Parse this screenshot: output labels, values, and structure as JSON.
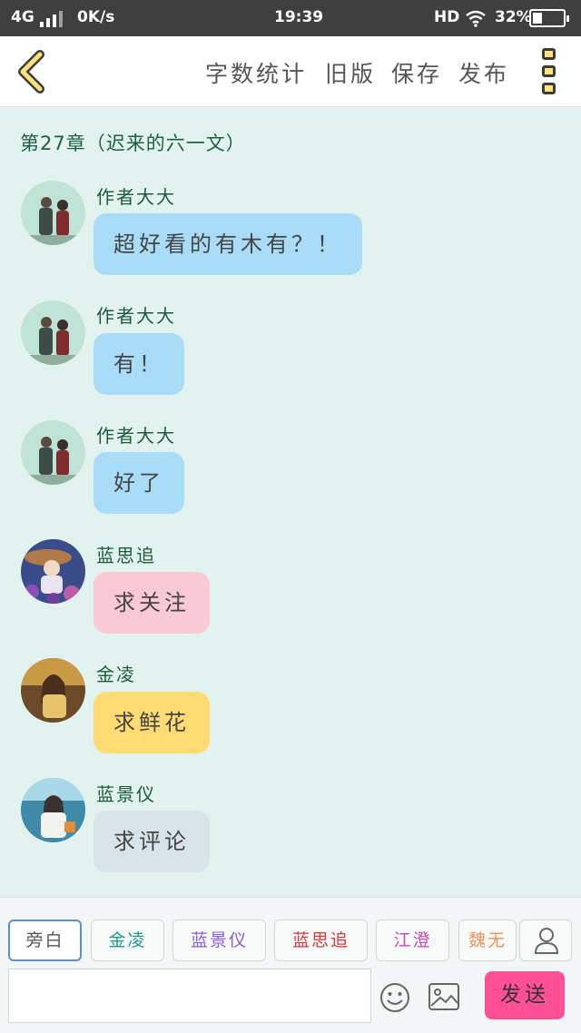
{
  "status_bar": {
    "network": "4G",
    "speed": "0K/s",
    "time": "19:39",
    "hd": "HD",
    "battery": "32%",
    "battery_level": 0.32
  },
  "toolbar": {
    "word_count": "字数统计",
    "old_version": "旧版",
    "save": "保存",
    "publish": "发布",
    "icons": {
      "back": "chevron-left-icon",
      "more": "more-vertical-icon"
    }
  },
  "chapter_title": "第27章（迟来的六一文）",
  "messages": [
    {
      "name": "作者大大",
      "text": "超好看的有木有？！",
      "bubble_color": "#a9dcf6"
    },
    {
      "name": "作者大大",
      "text": "有！",
      "bubble_color": "#a9dcf6"
    },
    {
      "name": "作者大大",
      "text": "好了",
      "bubble_color": "#a9dcf6"
    },
    {
      "name": "蓝思追",
      "text": "求关注",
      "bubble_color": "#f9c9d6"
    },
    {
      "name": "金凌",
      "text": "求鲜花",
      "bubble_color": "#fedb73"
    },
    {
      "name": "蓝景仪",
      "text": "求评论",
      "bubble_color": "#d9e4e9"
    }
  ],
  "roles": [
    {
      "label": "旁白",
      "color": "#555555"
    },
    {
      "label": "金凌",
      "color": "#1e9a8c"
    },
    {
      "label": "蓝景仪",
      "color": "#8c5cd6"
    },
    {
      "label": "蓝思追",
      "color": "#d6393e"
    },
    {
      "label": "江澄",
      "color": "#c64cb5"
    },
    {
      "label": "魏无",
      "color": "#e89560"
    }
  ],
  "composer": {
    "input_value": "",
    "send": "发送",
    "icons": {
      "emoji": "smiley-icon",
      "image": "image-icon",
      "user": "user-icon"
    }
  },
  "colors": {
    "chat_bg": "#e2f2ef",
    "accent_send": "#ff4f95",
    "name_color": "#1d5a3a"
  }
}
